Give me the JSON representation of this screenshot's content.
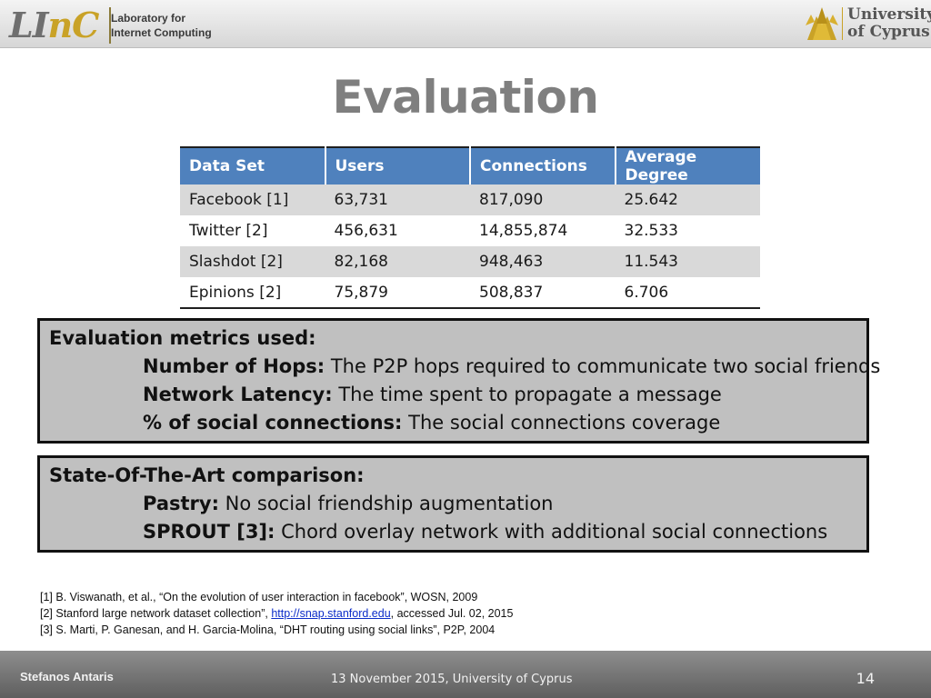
{
  "header": {
    "left_logo": {
      "mark": "LInC",
      "line1": "Laboratory for",
      "line2": "Internet Computing"
    },
    "right_logo": {
      "line1": "University",
      "line2": "of Cyprus",
      "accent": "#c9a227"
    }
  },
  "title": "Evaluation",
  "table": {
    "columns": [
      "Data Set",
      "Users",
      "Connections",
      "Average Degree"
    ],
    "rows": [
      [
        "Facebook [1]",
        "63,731",
        "817,090",
        "25.642"
      ],
      [
        "Twitter [2]",
        "456,631",
        "14,855,874",
        "32.533"
      ],
      [
        "Slashdot [2]",
        "82,168",
        "948,463",
        "11.543"
      ],
      [
        "Epinions [2]",
        "75,879",
        "508,837",
        "6.706"
      ]
    ],
    "header_color": "#4f81bd"
  },
  "metrics_box": {
    "heading": "Evaluation metrics used:",
    "items": [
      {
        "term": "Number of Hops:",
        "desc": " The P2P hops required to communicate two social friends"
      },
      {
        "term": "Network Latency:",
        "desc": " The time spent to propagate a message"
      },
      {
        "term": "% of social connections:",
        "desc": " The social connections coverage"
      }
    ]
  },
  "comparison_box": {
    "heading": "State-Of-The-Art comparison:",
    "items": [
      {
        "term": "Pastry:",
        "desc": " No social friendship augmentation"
      },
      {
        "term": "SPROUT [3]:",
        "desc": " Chord overlay network with additional social connections"
      }
    ]
  },
  "references": {
    "ref1": "[1] B. Viswanath, et al., “On the evolution of user interaction in facebook”, WOSN, 2009",
    "ref2_prefix": "[2] Stanford large network dataset collection”, ",
    "ref2_link": "http://snap.stanford.edu",
    "ref2_suffix": ", accessed Jul. 02, 2015",
    "ref3": "[3] S. Marti, P. Ganesan, and H. Garcia-Molina, “DHT routing using social links”, P2P, 2004"
  },
  "footer": {
    "author": "Stefanos Antaris",
    "date_place": "13 November 2015, University of Cyprus",
    "page_number": "14"
  }
}
